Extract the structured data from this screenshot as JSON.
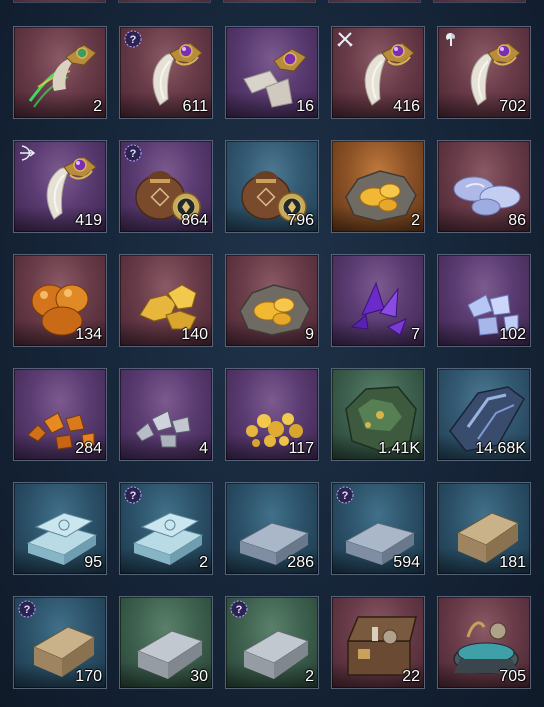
{
  "inventory": {
    "items": [
      {
        "art": "fang-green",
        "rarity": "red",
        "badge": "none",
        "qty": "2"
      },
      {
        "art": "fang",
        "rarity": "red",
        "badge": "question",
        "qty": "611"
      },
      {
        "art": "fang-broken",
        "rarity": "purple",
        "badge": "none",
        "qty": "16"
      },
      {
        "art": "fang",
        "rarity": "red",
        "badge": "swords",
        "qty": "416"
      },
      {
        "art": "fang",
        "rarity": "red",
        "badge": "axe",
        "qty": "702"
      },
      {
        "art": "fang",
        "rarity": "purple",
        "badge": "bow",
        "qty": "419"
      },
      {
        "art": "pouch",
        "rarity": "purple",
        "badge": "question",
        "qty": "864"
      },
      {
        "art": "pouch",
        "rarity": "blue",
        "badge": "none",
        "qty": "796"
      },
      {
        "art": "gold-ore-dish",
        "rarity": "orange",
        "badge": "none",
        "qty": "2"
      },
      {
        "art": "opal-stones",
        "rarity": "red",
        "badge": "none",
        "qty": "86"
      },
      {
        "art": "amber-stones",
        "rarity": "red",
        "badge": "none",
        "qty": "134"
      },
      {
        "art": "gold-nuggets",
        "rarity": "red",
        "badge": "none",
        "qty": "140"
      },
      {
        "art": "gold-ore-dish",
        "rarity": "red",
        "badge": "none",
        "qty": "9"
      },
      {
        "art": "amethyst-shards",
        "rarity": "purple",
        "badge": "none",
        "qty": "7"
      },
      {
        "art": "opal-shards",
        "rarity": "purple",
        "badge": "none",
        "qty": "102"
      },
      {
        "art": "amber-shards",
        "rarity": "purple",
        "badge": "none",
        "qty": "284"
      },
      {
        "art": "silver-shards",
        "rarity": "purple",
        "badge": "none",
        "qty": "4"
      },
      {
        "art": "gold-grains",
        "rarity": "purple",
        "badge": "none",
        "qty": "117"
      },
      {
        "art": "green-ore",
        "rarity": "green",
        "badge": "none",
        "qty": "1.41K"
      },
      {
        "art": "blue-ore",
        "rarity": "blue",
        "badge": "none",
        "qty": "14.68K"
      },
      {
        "art": "ice-ingot",
        "rarity": "ice",
        "badge": "none",
        "qty": "95"
      },
      {
        "art": "ice-ingot",
        "rarity": "ice",
        "badge": "question",
        "qty": "2"
      },
      {
        "art": "steel-ingot",
        "rarity": "ice",
        "badge": "none",
        "qty": "286"
      },
      {
        "art": "steel-ingot",
        "rarity": "ice",
        "badge": "question",
        "qty": "594"
      },
      {
        "art": "bronze-ingot",
        "rarity": "ice",
        "badge": "none",
        "qty": "181"
      },
      {
        "art": "bronze-ingot",
        "rarity": "ice",
        "badge": "question",
        "qty": "170"
      },
      {
        "art": "iron-ingot",
        "rarity": "green",
        "badge": "none",
        "qty": "30"
      },
      {
        "art": "iron-ingot",
        "rarity": "green",
        "badge": "question",
        "qty": "2"
      },
      {
        "art": "crafting-box",
        "rarity": "red",
        "badge": "none",
        "qty": "22"
      },
      {
        "art": "crafting-cauldron",
        "rarity": "red",
        "badge": "none",
        "qty": "705"
      }
    ]
  },
  "colors": {
    "background": "#162538",
    "slot_border": "#566377",
    "quantity_text": "#ffffff"
  }
}
